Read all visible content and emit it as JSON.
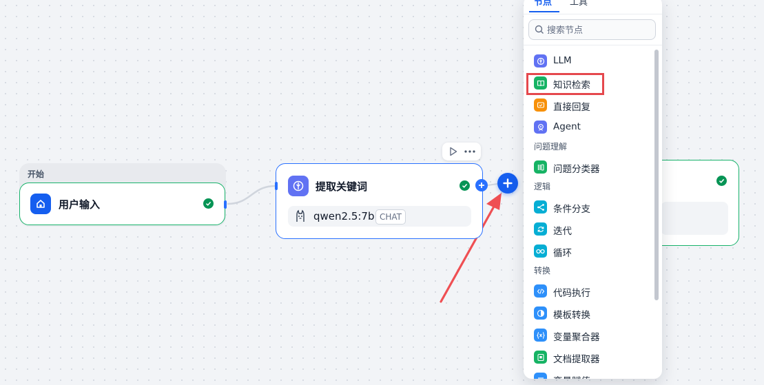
{
  "canvas": {
    "start_group_label": "开始",
    "start_node": {
      "title": "用户输入",
      "icon": "home-icon",
      "status": "success"
    },
    "llm_node": {
      "title": "提取关键词",
      "icon": "llm-icon",
      "model_name": "qwen2.5:7b",
      "model_badge": "CHAT",
      "model_icon": "llama-icon",
      "status": "success"
    },
    "right_node": {
      "status": "success"
    }
  },
  "panel": {
    "tabs": [
      {
        "label": "节点",
        "active": true
      },
      {
        "label": "工具",
        "active": false
      }
    ],
    "search_placeholder": "搜索节点",
    "items": [
      {
        "label": "LLM",
        "icon": "llm-icon",
        "color": "#6172f3"
      },
      {
        "label": "知识检索",
        "icon": "book-icon",
        "color": "#16b364",
        "highlighted": true
      },
      {
        "label": "直接回复",
        "icon": "reply-icon",
        "color": "#f79009"
      },
      {
        "label": "Agent",
        "icon": "agent-icon",
        "color": "#6172f3"
      }
    ],
    "sections": [
      {
        "title": "问题理解",
        "items": [
          {
            "label": "问题分类器",
            "icon": "classifier-icon",
            "color": "#16b364"
          }
        ]
      },
      {
        "title": "逻辑",
        "items": [
          {
            "label": "条件分支",
            "icon": "branch-icon",
            "color": "#06aed4"
          },
          {
            "label": "迭代",
            "icon": "iteration-icon",
            "color": "#06aed4"
          },
          {
            "label": "循环",
            "icon": "loop-icon",
            "color": "#06aed4"
          }
        ]
      },
      {
        "title": "转换",
        "items": [
          {
            "label": "代码执行",
            "icon": "code-icon",
            "color": "#2e90fa"
          },
          {
            "label": "模板转换",
            "icon": "template-icon",
            "color": "#2e90fa"
          },
          {
            "label": "变量聚合器",
            "icon": "variable-icon",
            "color": "#2e90fa"
          },
          {
            "label": "文档提取器",
            "icon": "doc-extract-icon",
            "color": "#16b364"
          },
          {
            "label": "变量赋值",
            "icon": "assign-icon",
            "color": "#2e90fa"
          }
        ]
      }
    ]
  },
  "colors": {
    "accent": "#155eef",
    "success": "#079455",
    "annotation": "#e5484d"
  }
}
